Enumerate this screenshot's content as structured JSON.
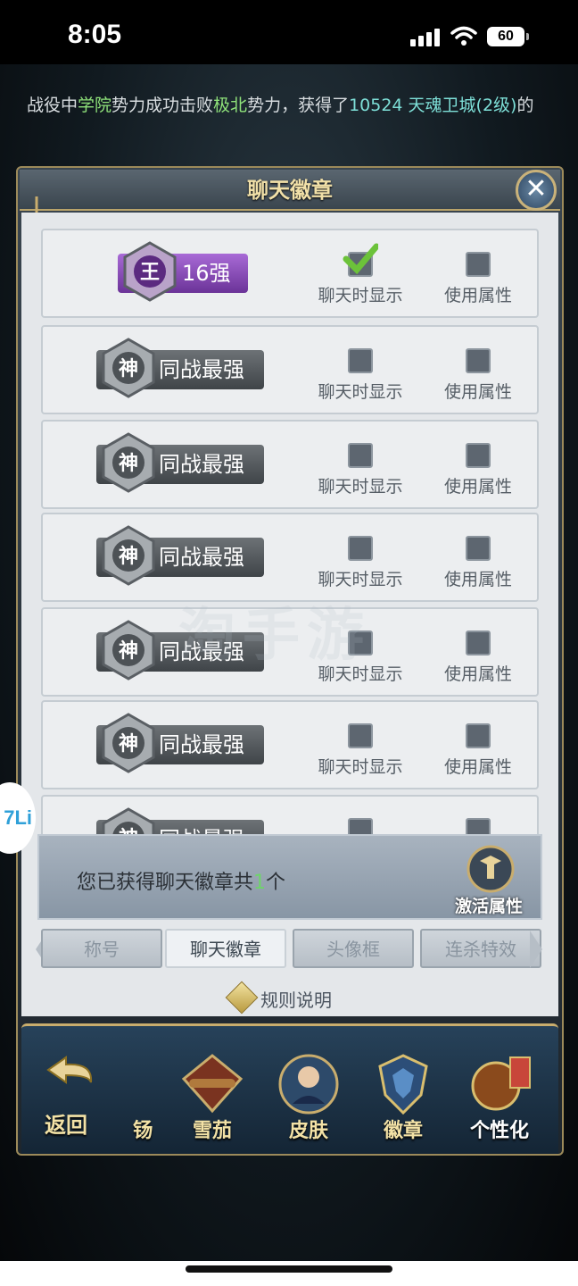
{
  "status_bar": {
    "time": "8:05",
    "battery": "60"
  },
  "broadcast": {
    "prefix": "战役中",
    "faction_a": "学院",
    "mid1": "势力成功击败",
    "faction_b": "极北",
    "mid2": "势力，获得了",
    "reward": "10524 天魂卫城(2级)",
    "suffix": "的"
  },
  "panel": {
    "title": "聊天徽章"
  },
  "badges": [
    {
      "emblem_char": "王",
      "name": "16强",
      "style": "purple",
      "show_in_chat": true,
      "use_attribute": false
    },
    {
      "emblem_char": "神",
      "name": "同战最强",
      "style": "gray",
      "show_in_chat": false,
      "use_attribute": false
    },
    {
      "emblem_char": "神",
      "name": "同战最强",
      "style": "gray",
      "show_in_chat": false,
      "use_attribute": false
    },
    {
      "emblem_char": "神",
      "name": "同战最强",
      "style": "gray",
      "show_in_chat": false,
      "use_attribute": false
    },
    {
      "emblem_char": "神",
      "name": "同战最强",
      "style": "gray",
      "show_in_chat": false,
      "use_attribute": false
    },
    {
      "emblem_char": "神",
      "name": "同战最强",
      "style": "gray",
      "show_in_chat": false,
      "use_attribute": false
    },
    {
      "emblem_char": "神",
      "name": "同战最强",
      "style": "gray",
      "show_in_chat": false,
      "use_attribute": false
    }
  ],
  "labels": {
    "show_in_chat": "聊天时显示",
    "use_attribute": "使用属性"
  },
  "summary": {
    "prefix": "您已获得聊天徽章共",
    "count": "1",
    "suffix": "个",
    "activate": "激活属性"
  },
  "tabs": [
    {
      "label": "称号",
      "active": false
    },
    {
      "label": "聊天徽章",
      "active": true
    },
    {
      "label": "头像框",
      "active": false
    },
    {
      "label": "连杀特效",
      "active": false
    }
  ],
  "rules": {
    "label": "规则说明"
  },
  "bottom_nav": {
    "back": "返回",
    "partial": "钖",
    "items": [
      {
        "label": "雪茄",
        "icon": "cigar-icon",
        "active": false
      },
      {
        "label": "皮肤",
        "icon": "skin-hero-icon",
        "active": false
      },
      {
        "label": "徽章",
        "icon": "badge-icon",
        "active": false
      },
      {
        "label": "个性化",
        "icon": "personalize-icon",
        "active": true
      }
    ]
  },
  "watermark": "淘手游",
  "float_logo": "7Li",
  "colors": {
    "accent_gold": "#c9ad6d",
    "active_tab": "#eef1f4",
    "count_green": "#6fd46b"
  }
}
